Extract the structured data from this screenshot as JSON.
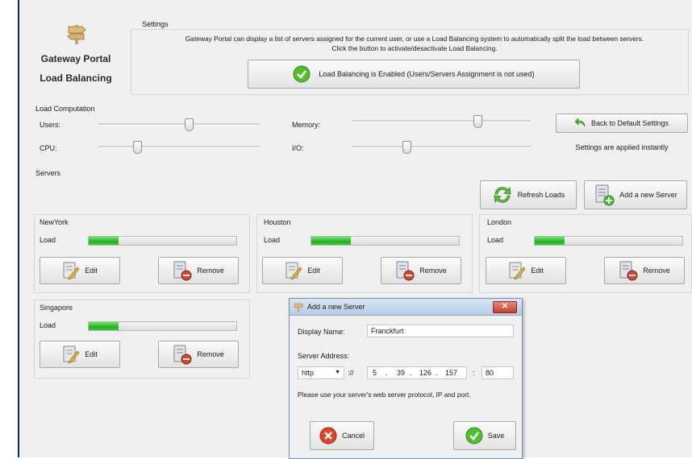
{
  "brand": {
    "title_line1": "Gateway Portal",
    "title_line2": "Load Balancing"
  },
  "settings": {
    "title": "Settings",
    "description": "Gateway Portal can display a list of servers assigned for the current user, or use a Load Balancing system to automatically split the load between servers.",
    "instruction": "Click the button to activate/desactivate Load Balancing.",
    "toggle_label": "Load Balancing is Enabled (Users/Servers Assignment is not used)"
  },
  "load_computation": {
    "title": "Load Computation",
    "sliders": [
      {
        "label": "Users:",
        "level": 0.5
      },
      {
        "label": "Memory:",
        "level": 0.7
      },
      {
        "label": "CPU:",
        "level": 0.2
      },
      {
        "label": "I/O:",
        "level": 0.3
      }
    ],
    "default_button": "Back to Default Settings",
    "note": "Settings are applied instantly"
  },
  "servers": {
    "title": "Servers",
    "refresh_button": "Refresh Loads",
    "add_button": "Add a new Server",
    "load_label": "Load",
    "edit_label": "Edit",
    "remove_label": "Remove",
    "list": [
      {
        "name": "NewYork",
        "load": 0.2
      },
      {
        "name": "Houston",
        "load": 0.27
      },
      {
        "name": "London",
        "load": 0.2
      },
      {
        "name": "Singapore",
        "load": 0.2
      }
    ]
  },
  "dialog": {
    "title": "Add a new Server",
    "display_name_label": "Display Name:",
    "display_name_value": "Franckfurt",
    "address_label": "Server Address:",
    "protocol": "http",
    "separator": "://",
    "ip_parts": [
      "5",
      "39",
      "126",
      "157"
    ],
    "port_separator": ":",
    "port": "80",
    "hint": "Please use your server's web server protocol, IP and port.",
    "cancel_label": "Cancel",
    "save_label": "Save"
  },
  "colors": {
    "load_green": "#23b023",
    "title_blue": "#0d2b6e"
  }
}
